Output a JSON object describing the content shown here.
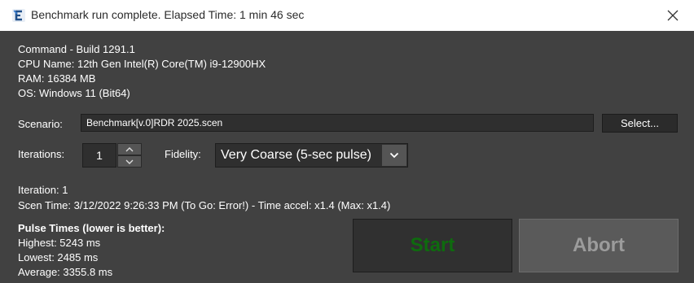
{
  "window": {
    "title": "Benchmark run complete. Elapsed Time: 1 min 46 sec"
  },
  "system_info": {
    "command": "Command - Build 1291.1",
    "cpu": "CPU Name: 12th Gen Intel(R) Core(TM) i9-12900HX",
    "ram": "RAM: 16384 MB",
    "os": "OS: Windows 11 (Bit64)"
  },
  "scenario": {
    "label": "Scenario:",
    "value": "Benchmark[v.0]RDR 2025.scen",
    "select_label": "Select..."
  },
  "iterations": {
    "label": "Iterations:",
    "value": "1"
  },
  "fidelity": {
    "label": "Fidelity:",
    "value": "Very Coarse (5-sec pulse)"
  },
  "status": {
    "iteration": "Iteration: 1",
    "scen_time": "Scen Time: 3/12/2022 9:26:33 PM (To Go: Error!) - Time accel: x1.4 (Max: x1.4)"
  },
  "pulse_times": {
    "header": "Pulse Times (lower is better):",
    "highest": "Highest: 5243 ms",
    "lowest": "Lowest: 2485 ms",
    "average": "Average: 3355.8 ms"
  },
  "actions": {
    "start_label": "Start",
    "abort_label": "Abort"
  },
  "colors": {
    "background": "#414141",
    "start_text": "#0e6b0e",
    "abort_text": "#9c9c9c"
  },
  "icons": {
    "app": "app-logo-icon",
    "close": "close-icon",
    "spin_up": "chevron-up-icon",
    "spin_down": "chevron-down-icon",
    "dropdown": "chevron-down-icon"
  }
}
